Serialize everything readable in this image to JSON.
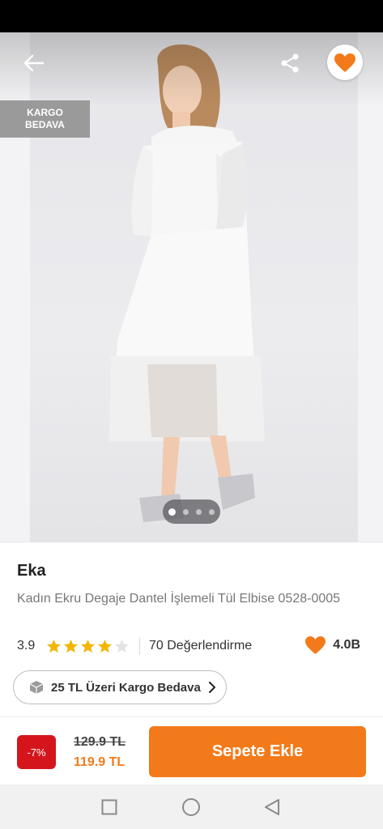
{
  "hero": {
    "cargo_badge_line1": "KARGO",
    "cargo_badge_line2": "BEDAVA",
    "image_count": 4,
    "active_image_index": 0,
    "favorited": true
  },
  "product": {
    "brand": "Eka",
    "name": "Kadın Ekru Degaje Dantel İşlemeli Tül Elbise 0528-0005",
    "rating": "3.9",
    "rating_value": 3.9,
    "stars_filled": 4,
    "stars_total": 5,
    "reviews_label": "70 Değerlendirme",
    "favorites_count": "4.0B"
  },
  "shipping_chip": {
    "label": "25 TL Üzeri Kargo Bedava"
  },
  "purchase": {
    "discount": "-7%",
    "old_price": "129.9 TL",
    "new_price": "119.9 TL",
    "add_to_cart_label": "Sepete Ekle"
  },
  "colors": {
    "brand_orange": "#f27a1a",
    "discount_red": "#d4161c",
    "star_yellow": "#f2b600"
  },
  "icons": {
    "back": "arrow-left-icon",
    "share": "share-icon",
    "favorite": "heart-icon",
    "shipping": "box-icon",
    "chevron": "chevron-right-icon",
    "nav_recents": "square-icon",
    "nav_home": "circle-icon",
    "nav_back": "triangle-back-icon"
  }
}
